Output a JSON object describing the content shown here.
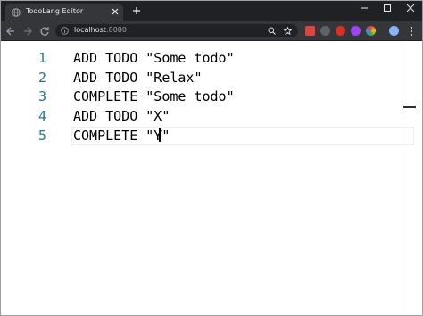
{
  "browser": {
    "tab_title": "TodoLang Editor",
    "url_host": "localhost",
    "url_port": ":8080",
    "icons": {
      "back": "back-arrow-icon",
      "forward": "forward-arrow-icon",
      "reload": "reload-icon",
      "lock": "info-icon",
      "zoom": "zoom-icon",
      "bookmark": "star-icon",
      "newtab": "plus-icon",
      "close": "close-icon",
      "minimize": "minimize-icon",
      "maximize": "maximize-icon",
      "menu": "kebab-menu-icon"
    },
    "extensions": [
      {
        "name": "ext-red-icon",
        "color": "#e0443e"
      },
      {
        "name": "ext-grey-icon",
        "color": "#9aa0a6"
      },
      {
        "name": "ext-red2-icon",
        "color": "#d93025"
      },
      {
        "name": "ext-purple-icon",
        "color": "#a142f4"
      },
      {
        "name": "ext-colorwheel-icon",
        "color": "#34a853"
      },
      {
        "name": "ext-profile-icon",
        "color": "#8ab4f8"
      }
    ]
  },
  "editor": {
    "lines": [
      {
        "number": "1",
        "text": "ADD TODO \"Some todo\""
      },
      {
        "number": "2",
        "text": "ADD TODO \"Relax\""
      },
      {
        "number": "3",
        "text": "COMPLETE \"Some todo\""
      },
      {
        "number": "4",
        "text": "ADD TODO \"X\""
      },
      {
        "number": "5",
        "text": "COMPLETE \"Y\""
      }
    ],
    "current_line": 5,
    "colors": {
      "line_number": "#237893",
      "text": "#000000"
    }
  }
}
